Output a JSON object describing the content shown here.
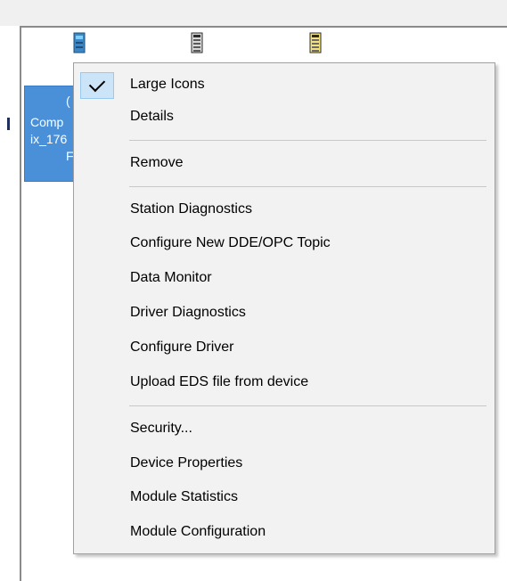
{
  "selected_item": {
    "line1": "Comp",
    "line2": "ix_176",
    "line3": "F"
  },
  "icons": [
    "device-module-icon-blue",
    "device-module-icon-gray",
    "device-module-icon-yellow"
  ],
  "context_menu": {
    "large_icons": "Large Icons",
    "details": "Details",
    "remove": "Remove",
    "station_diagnostics": "Station Diagnostics",
    "configure_new_topic": "Configure New DDE/OPC Topic",
    "data_monitor": "Data Monitor",
    "driver_diagnostics": "Driver Diagnostics",
    "configure_driver": "Configure Driver",
    "upload_eds": "Upload EDS file from device",
    "security": "Security...",
    "device_properties": "Device Properties",
    "module_statistics": "Module Statistics",
    "module_configuration": "Module Configuration",
    "checked_item": "Large Icons"
  },
  "colors": {
    "selection": "#4a90d9",
    "menu_background": "#f2f2f2",
    "check_highlight": "#cce4f7"
  }
}
